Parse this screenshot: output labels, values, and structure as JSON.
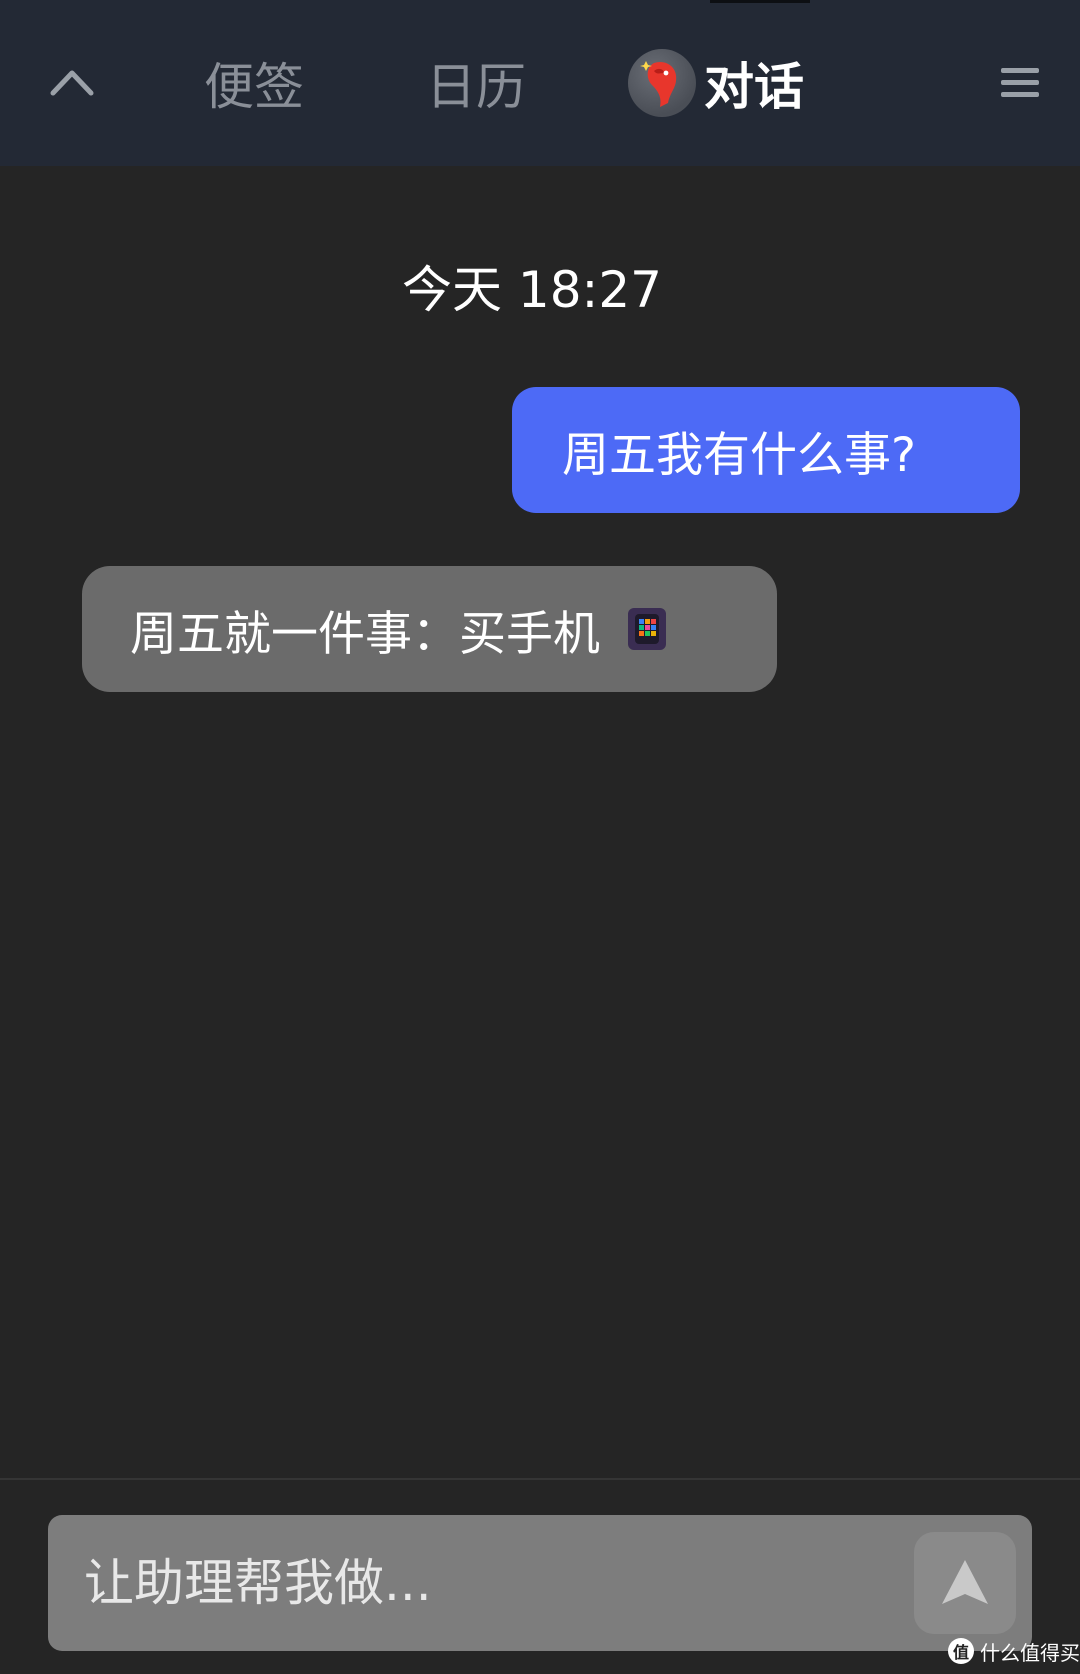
{
  "header": {
    "tabs": [
      {
        "label": "便签",
        "active": false
      },
      {
        "label": "日历",
        "active": false
      },
      {
        "label": "对话",
        "active": true
      }
    ],
    "icons": {
      "collapse": "chevron-up-icon",
      "assistant": "assistant-avatar-icon",
      "menu": "hamburger-menu-icon"
    }
  },
  "chat": {
    "timestamp": "今天 18:27",
    "messages": [
      {
        "role": "user",
        "text": "周五我有什么事?"
      },
      {
        "role": "assistant",
        "text": "周五就一件事：买手机",
        "emoji": "mobile-phone-emoji"
      }
    ]
  },
  "input": {
    "placeholder": "让助理帮我做...",
    "value": "",
    "send_icon": "send-arrow-icon"
  },
  "watermark": {
    "text": "什么值得买",
    "logo_char": "值"
  },
  "colors": {
    "header_bg": "#232935",
    "chat_bg": "#252525",
    "user_bubble": "#4d6af6",
    "assistant_bubble": "#6b6b6b",
    "input_bg": "#7d7d7d",
    "inactive_tab": "#8a8f98"
  }
}
